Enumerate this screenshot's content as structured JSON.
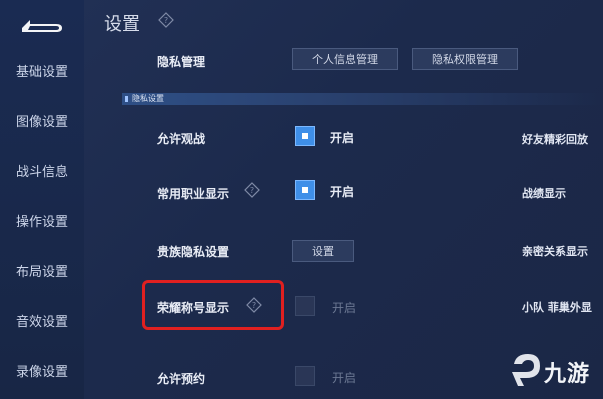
{
  "header": {
    "title": "设置"
  },
  "sidebar": {
    "items": [
      {
        "label": "基础设置"
      },
      {
        "label": "图像设置"
      },
      {
        "label": "战斗信息"
      },
      {
        "label": "操作设置"
      },
      {
        "label": "布局设置"
      },
      {
        "label": "音效设置"
      },
      {
        "label": "录像设置"
      }
    ]
  },
  "privacy_management": {
    "label": "隐私管理",
    "personal_info_button": "个人信息管理",
    "privacy_permission_button": "隐私权限管理"
  },
  "section": {
    "title": "隐私设置"
  },
  "rows": [
    {
      "label": "允许观战",
      "state": "开启",
      "checked": true
    },
    {
      "label": "常用职业显示",
      "state": "开启",
      "checked": true
    },
    {
      "label": "贵族隐私设置",
      "button": "设置"
    },
    {
      "label": "荣耀称号显示",
      "state": "开启",
      "checked": false
    },
    {
      "label": "允许预约",
      "state": "开启",
      "checked": false
    }
  ],
  "right_column": [
    {
      "label": "好友精彩回放"
    },
    {
      "label": "战绩显示"
    },
    {
      "label": "亲密关系显示"
    },
    {
      "label": "小队 菲巢外显"
    }
  ],
  "watermark": {
    "text": "九游"
  },
  "colors": {
    "highlight": "#e02020",
    "checkbox_on": "#3f8fe8",
    "background": "#1c2a4c"
  }
}
